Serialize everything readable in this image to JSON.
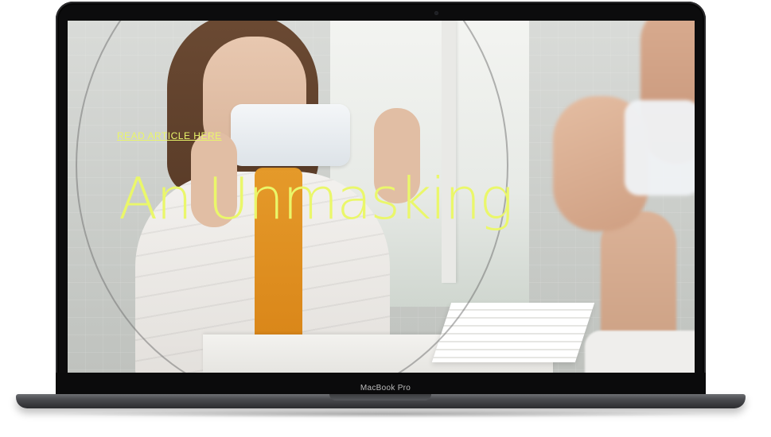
{
  "page": {
    "link_text": "READ ARTICLE HERE",
    "headline": "An Unmasking",
    "accent_color": "#eaf76a"
  },
  "device": {
    "model_label": "MacBook Pro"
  }
}
